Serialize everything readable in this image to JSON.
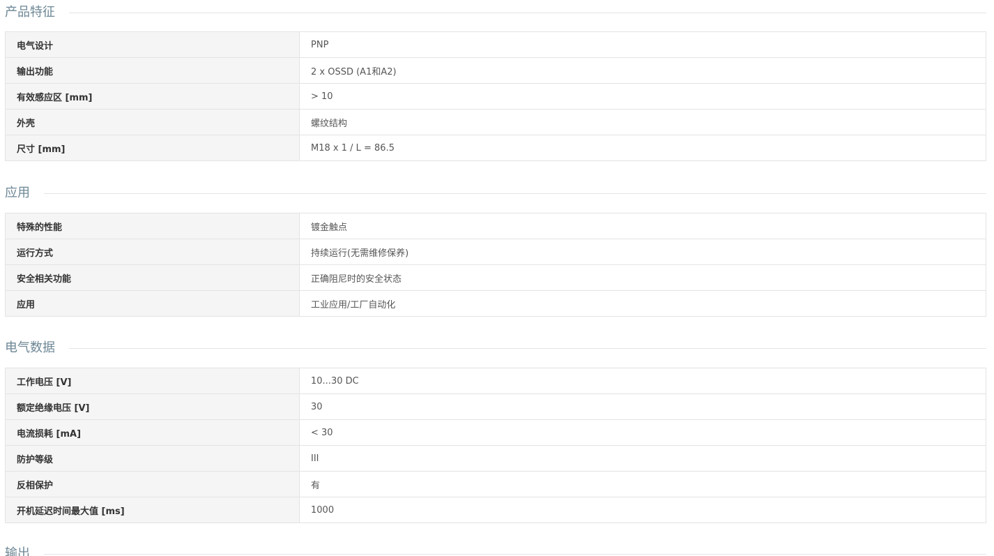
{
  "sections": [
    {
      "title": "产品特征",
      "rows": [
        {
          "label": "电气设计",
          "value": "PNP"
        },
        {
          "label": "输出功能",
          "value": "2 x OSSD (A1和A2)"
        },
        {
          "label": "有效感应区 [mm]",
          "value": "> 10"
        },
        {
          "label": "外壳",
          "value": "螺纹结构"
        },
        {
          "label": "尺寸 [mm]",
          "value": "M18 x 1 / L = 86.5"
        }
      ]
    },
    {
      "title": "应用",
      "rows": [
        {
          "label": "特殊的性能",
          "value": "镀金触点"
        },
        {
          "label": "运行方式",
          "value": "持续运行(无需维修保养)"
        },
        {
          "label": "安全相关功能",
          "value": "正确阻尼时的安全状态"
        },
        {
          "label": "应用",
          "value": "工业应用/工厂自动化"
        }
      ]
    },
    {
      "title": "电气数据",
      "rows": [
        {
          "label": "工作电压 [V]",
          "value": "10...30 DC"
        },
        {
          "label": "额定绝缘电压 [V]",
          "value": "30"
        },
        {
          "label": "电流损耗 [mA]",
          "value": "< 30"
        },
        {
          "label": "防护等级",
          "value": "III"
        },
        {
          "label": "反相保护",
          "value": "有"
        },
        {
          "label": "开机延迟时间最大值 [ms]",
          "value": "1000"
        }
      ]
    },
    {
      "title": "输出",
      "rows": []
    }
  ]
}
